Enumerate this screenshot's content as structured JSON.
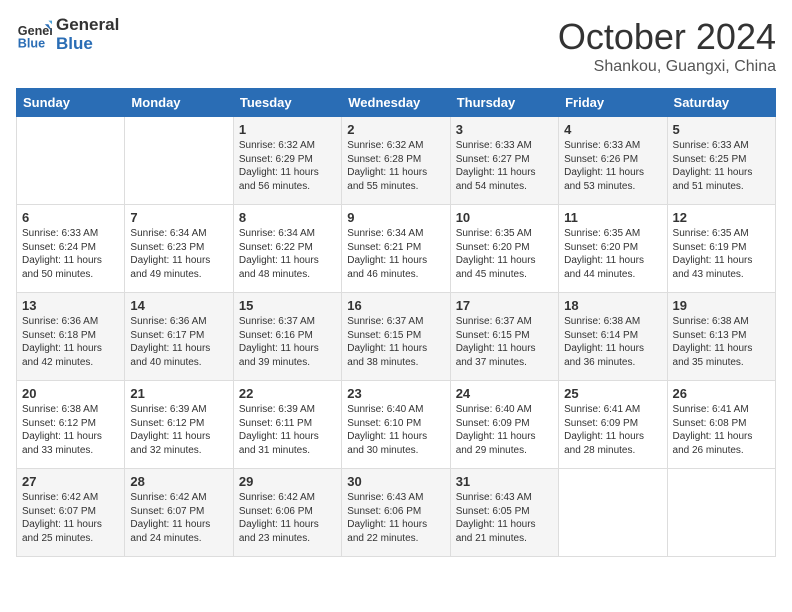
{
  "header": {
    "logo_line1": "General",
    "logo_line2": "Blue",
    "month": "October 2024",
    "location": "Shankou, Guangxi, China"
  },
  "days_of_week": [
    "Sunday",
    "Monday",
    "Tuesday",
    "Wednesday",
    "Thursday",
    "Friday",
    "Saturday"
  ],
  "weeks": [
    [
      {
        "day": "",
        "sunrise": "",
        "sunset": "",
        "daylight": ""
      },
      {
        "day": "",
        "sunrise": "",
        "sunset": "",
        "daylight": ""
      },
      {
        "day": "1",
        "sunrise": "Sunrise: 6:32 AM",
        "sunset": "Sunset: 6:29 PM",
        "daylight": "Daylight: 11 hours and 56 minutes."
      },
      {
        "day": "2",
        "sunrise": "Sunrise: 6:32 AM",
        "sunset": "Sunset: 6:28 PM",
        "daylight": "Daylight: 11 hours and 55 minutes."
      },
      {
        "day": "3",
        "sunrise": "Sunrise: 6:33 AM",
        "sunset": "Sunset: 6:27 PM",
        "daylight": "Daylight: 11 hours and 54 minutes."
      },
      {
        "day": "4",
        "sunrise": "Sunrise: 6:33 AM",
        "sunset": "Sunset: 6:26 PM",
        "daylight": "Daylight: 11 hours and 53 minutes."
      },
      {
        "day": "5",
        "sunrise": "Sunrise: 6:33 AM",
        "sunset": "Sunset: 6:25 PM",
        "daylight": "Daylight: 11 hours and 51 minutes."
      }
    ],
    [
      {
        "day": "6",
        "sunrise": "Sunrise: 6:33 AM",
        "sunset": "Sunset: 6:24 PM",
        "daylight": "Daylight: 11 hours and 50 minutes."
      },
      {
        "day": "7",
        "sunrise": "Sunrise: 6:34 AM",
        "sunset": "Sunset: 6:23 PM",
        "daylight": "Daylight: 11 hours and 49 minutes."
      },
      {
        "day": "8",
        "sunrise": "Sunrise: 6:34 AM",
        "sunset": "Sunset: 6:22 PM",
        "daylight": "Daylight: 11 hours and 48 minutes."
      },
      {
        "day": "9",
        "sunrise": "Sunrise: 6:34 AM",
        "sunset": "Sunset: 6:21 PM",
        "daylight": "Daylight: 11 hours and 46 minutes."
      },
      {
        "day": "10",
        "sunrise": "Sunrise: 6:35 AM",
        "sunset": "Sunset: 6:20 PM",
        "daylight": "Daylight: 11 hours and 45 minutes."
      },
      {
        "day": "11",
        "sunrise": "Sunrise: 6:35 AM",
        "sunset": "Sunset: 6:20 PM",
        "daylight": "Daylight: 11 hours and 44 minutes."
      },
      {
        "day": "12",
        "sunrise": "Sunrise: 6:35 AM",
        "sunset": "Sunset: 6:19 PM",
        "daylight": "Daylight: 11 hours and 43 minutes."
      }
    ],
    [
      {
        "day": "13",
        "sunrise": "Sunrise: 6:36 AM",
        "sunset": "Sunset: 6:18 PM",
        "daylight": "Daylight: 11 hours and 42 minutes."
      },
      {
        "day": "14",
        "sunrise": "Sunrise: 6:36 AM",
        "sunset": "Sunset: 6:17 PM",
        "daylight": "Daylight: 11 hours and 40 minutes."
      },
      {
        "day": "15",
        "sunrise": "Sunrise: 6:37 AM",
        "sunset": "Sunset: 6:16 PM",
        "daylight": "Daylight: 11 hours and 39 minutes."
      },
      {
        "day": "16",
        "sunrise": "Sunrise: 6:37 AM",
        "sunset": "Sunset: 6:15 PM",
        "daylight": "Daylight: 11 hours and 38 minutes."
      },
      {
        "day": "17",
        "sunrise": "Sunrise: 6:37 AM",
        "sunset": "Sunset: 6:15 PM",
        "daylight": "Daylight: 11 hours and 37 minutes."
      },
      {
        "day": "18",
        "sunrise": "Sunrise: 6:38 AM",
        "sunset": "Sunset: 6:14 PM",
        "daylight": "Daylight: 11 hours and 36 minutes."
      },
      {
        "day": "19",
        "sunrise": "Sunrise: 6:38 AM",
        "sunset": "Sunset: 6:13 PM",
        "daylight": "Daylight: 11 hours and 35 minutes."
      }
    ],
    [
      {
        "day": "20",
        "sunrise": "Sunrise: 6:38 AM",
        "sunset": "Sunset: 6:12 PM",
        "daylight": "Daylight: 11 hours and 33 minutes."
      },
      {
        "day": "21",
        "sunrise": "Sunrise: 6:39 AM",
        "sunset": "Sunset: 6:12 PM",
        "daylight": "Daylight: 11 hours and 32 minutes."
      },
      {
        "day": "22",
        "sunrise": "Sunrise: 6:39 AM",
        "sunset": "Sunset: 6:11 PM",
        "daylight": "Daylight: 11 hours and 31 minutes."
      },
      {
        "day": "23",
        "sunrise": "Sunrise: 6:40 AM",
        "sunset": "Sunset: 6:10 PM",
        "daylight": "Daylight: 11 hours and 30 minutes."
      },
      {
        "day": "24",
        "sunrise": "Sunrise: 6:40 AM",
        "sunset": "Sunset: 6:09 PM",
        "daylight": "Daylight: 11 hours and 29 minutes."
      },
      {
        "day": "25",
        "sunrise": "Sunrise: 6:41 AM",
        "sunset": "Sunset: 6:09 PM",
        "daylight": "Daylight: 11 hours and 28 minutes."
      },
      {
        "day": "26",
        "sunrise": "Sunrise: 6:41 AM",
        "sunset": "Sunset: 6:08 PM",
        "daylight": "Daylight: 11 hours and 26 minutes."
      }
    ],
    [
      {
        "day": "27",
        "sunrise": "Sunrise: 6:42 AM",
        "sunset": "Sunset: 6:07 PM",
        "daylight": "Daylight: 11 hours and 25 minutes."
      },
      {
        "day": "28",
        "sunrise": "Sunrise: 6:42 AM",
        "sunset": "Sunset: 6:07 PM",
        "daylight": "Daylight: 11 hours and 24 minutes."
      },
      {
        "day": "29",
        "sunrise": "Sunrise: 6:42 AM",
        "sunset": "Sunset: 6:06 PM",
        "daylight": "Daylight: 11 hours and 23 minutes."
      },
      {
        "day": "30",
        "sunrise": "Sunrise: 6:43 AM",
        "sunset": "Sunset: 6:06 PM",
        "daylight": "Daylight: 11 hours and 22 minutes."
      },
      {
        "day": "31",
        "sunrise": "Sunrise: 6:43 AM",
        "sunset": "Sunset: 6:05 PM",
        "daylight": "Daylight: 11 hours and 21 minutes."
      },
      {
        "day": "",
        "sunrise": "",
        "sunset": "",
        "daylight": ""
      },
      {
        "day": "",
        "sunrise": "",
        "sunset": "",
        "daylight": ""
      }
    ]
  ]
}
